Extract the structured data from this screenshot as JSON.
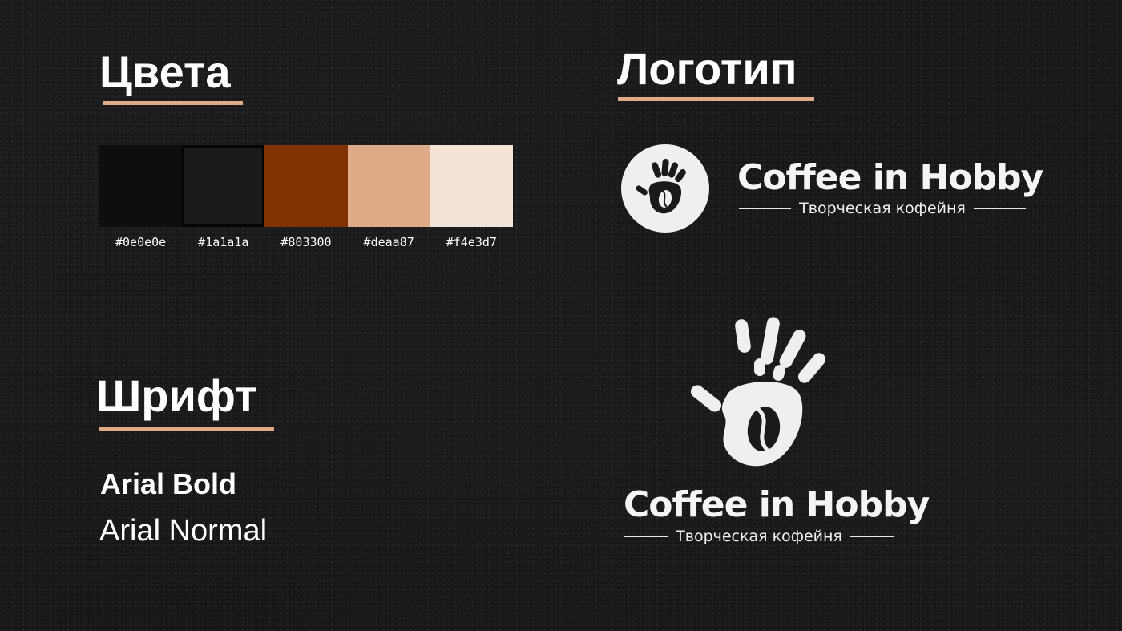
{
  "sections": {
    "colors_title": "Цвета",
    "logo_title": "Логотип",
    "font_title": "Шрифт"
  },
  "palette": [
    {
      "hex": "#0e0e0e",
      "label": "#0e0e0e"
    },
    {
      "hex": "#1a1a1a",
      "label": "#1a1a1a"
    },
    {
      "hex": "#803300",
      "label": "#803300"
    },
    {
      "hex": "#deaa87",
      "label": "#deaa87"
    },
    {
      "hex": "#f4e3d7",
      "label": "#f4e3d7"
    }
  ],
  "fonts": {
    "bold_sample": "Arial Bold",
    "normal_sample": "Arial Normal"
  },
  "logo": {
    "brand_name": "Coffee in Hobby",
    "tagline": "Творческая кофейня",
    "icon": "handprint-coffee-bean-icon"
  },
  "colors": {
    "background": "#1a1a1a",
    "accent": "#deaa87",
    "text": "#ffffff",
    "logo_fill": "#efefef"
  }
}
